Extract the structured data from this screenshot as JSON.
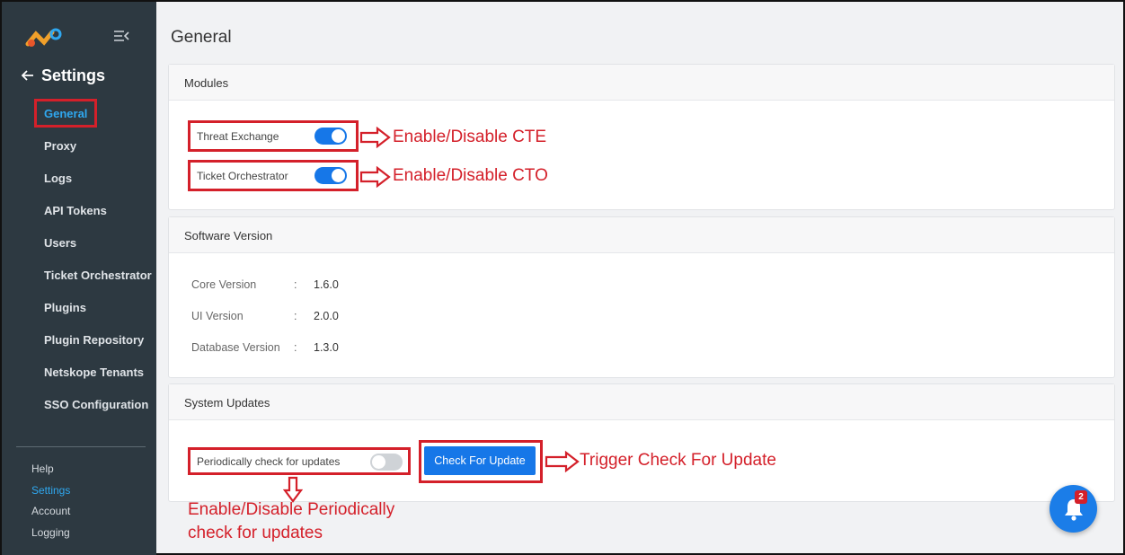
{
  "sidebar": {
    "back_title": "Settings",
    "nav_items": [
      "General",
      "Proxy",
      "Logs",
      "API Tokens",
      "Users",
      "Ticket Orchestrator",
      "Plugins",
      "Plugin Repository",
      "Netskope Tenants",
      "SSO Configuration"
    ],
    "active_item": "General",
    "bottom_items": [
      "Help",
      "Settings",
      "Account",
      "Logging"
    ],
    "bottom_active": "Settings"
  },
  "page": {
    "title": "General"
  },
  "modules": {
    "header": "Modules",
    "items": [
      {
        "label": "Threat Exchange",
        "enabled": true
      },
      {
        "label": "Ticket Orchestrator",
        "enabled": true
      }
    ]
  },
  "software_version": {
    "header": "Software Version",
    "rows": [
      {
        "label": "Core Version",
        "value": "1.6.0"
      },
      {
        "label": "UI Version",
        "value": "2.0.0"
      },
      {
        "label": "Database Version",
        "value": "1.3.0"
      }
    ],
    "separator": ":"
  },
  "system_updates": {
    "header": "System Updates",
    "periodic_label": "Periodically check for updates",
    "periodic_enabled": false,
    "check_button": "Check For Update"
  },
  "annotations": {
    "cte": "Enable/Disable CTE",
    "cto": "Enable/Disable CTO",
    "check": "Trigger Check For Update",
    "periodic_line1": "Enable/Disable Periodically",
    "periodic_line2": "check for updates"
  },
  "notifications": {
    "count": "2"
  },
  "colors": {
    "accent": "#1677e8",
    "sidebar": "#2d3941",
    "annotation": "#d4202a",
    "active_nav": "#2fa8f0"
  }
}
